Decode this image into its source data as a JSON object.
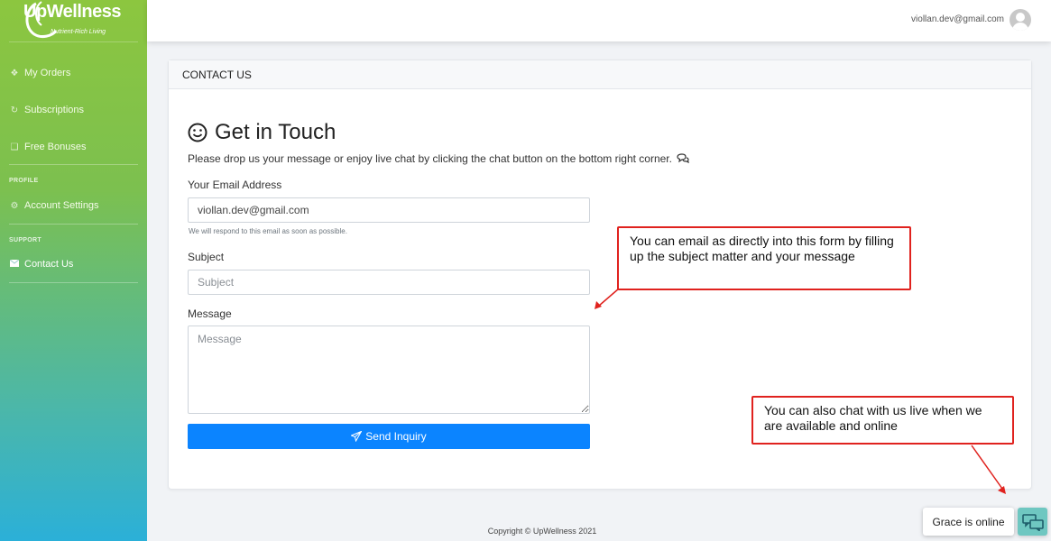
{
  "brand": {
    "name": "UpWellness",
    "tagline": "Nutrient-Rich Living"
  },
  "sidebar": {
    "items": [
      {
        "label": "My Orders",
        "icon": "cubes-icon"
      },
      {
        "label": "Subscriptions",
        "icon": "refresh-icon"
      },
      {
        "label": "Free Bonuses",
        "icon": "gift-icon"
      }
    ],
    "profile_section": "PROFILE",
    "profile_items": [
      {
        "label": "Account Settings",
        "icon": "gear-icon"
      }
    ],
    "support_section": "SUPPORT",
    "support_items": [
      {
        "label": "Contact Us",
        "icon": "envelope-icon"
      }
    ]
  },
  "topbar": {
    "user_email": "viollan.dev@gmail.com"
  },
  "card": {
    "header": "CONTACT US",
    "title": "Get in Touch",
    "description": "Please drop us your message or enjoy live chat by clicking the chat button on the bottom right corner.",
    "email_label": "Your Email Address",
    "email_value": "viollan.dev@gmail.com",
    "email_help": "We will respond to this email as soon as possible.",
    "subject_label": "Subject",
    "subject_placeholder": "Subject",
    "message_label": "Message",
    "message_placeholder": "Message",
    "send_label": "Send Inquiry"
  },
  "callouts": {
    "email": "You can email as directly into this form by filling up the subject matter and your message",
    "chat": "You can also chat with us live when we are available and online"
  },
  "footer": {
    "copyright": "Copyright © UpWellness 2021"
  },
  "chat": {
    "status": "Grace is online"
  },
  "colors": {
    "accent": "#0b84ff",
    "callout_border": "#e0221e",
    "sidebar_top": "#8cc63f",
    "sidebar_bottom": "#2bb0d8",
    "chat_button": "#6fc7c1"
  }
}
